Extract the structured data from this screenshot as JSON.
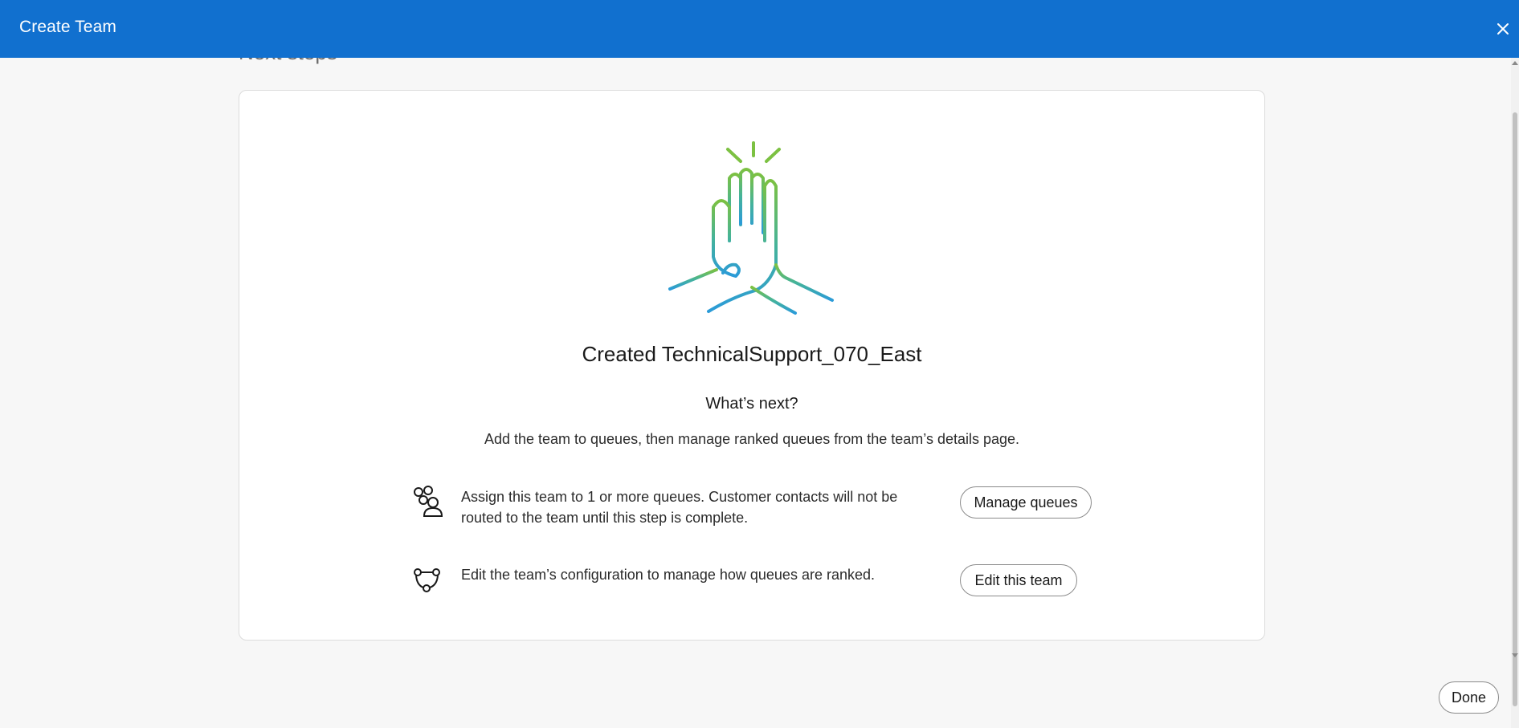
{
  "dialog": {
    "title": "Create Team",
    "close_icon": "close-icon"
  },
  "section": {
    "heading": "Next steps"
  },
  "success": {
    "illustration": "high-five-icon",
    "title": "Created TechnicalSupport_070_East",
    "whats_next": "What’s next?",
    "description": "Add the team to queues, then manage ranked queues from the team’s details page."
  },
  "steps": [
    {
      "icon": "team-members-icon",
      "text": "Assign this team to 1 or more queues. Customer contacts will not be routed to the team until this step is complete.",
      "button_label": "Manage queues"
    },
    {
      "icon": "team-network-icon",
      "text": "Edit the team’s configuration to manage how queues are ranked.",
      "button_label": "Edit this team"
    }
  ],
  "footer": {
    "done_label": "Done"
  },
  "colors": {
    "header": "#1170cf",
    "illustration_green": "#7cc142",
    "illustration_blue": "#2b9bd8"
  }
}
